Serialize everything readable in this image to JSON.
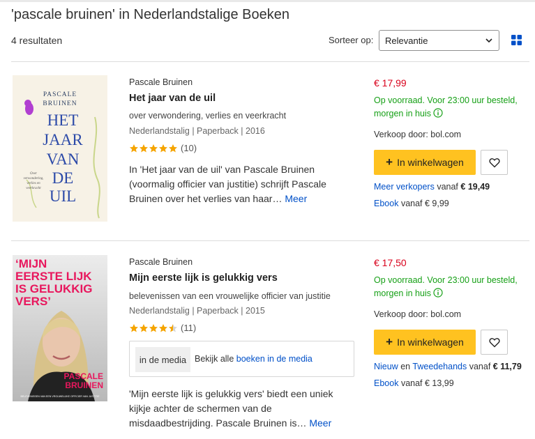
{
  "page": {
    "title": "'pascale bruinen' in Nederlandstalige Boeken",
    "result_count": "4 resultaten",
    "sort_label": "Sorteer op:",
    "sort_value": "Relevantie"
  },
  "colors": {
    "accent_button": "#ffc220",
    "price": "#d9001b",
    "stock": "#16a016",
    "link": "#0050c8"
  },
  "products": [
    {
      "author": "Pascale Bruinen",
      "title": "Het jaar van de uil",
      "subtitle": "over verwondering, verlies en veerkracht",
      "meta": "Nederlandstalig | Paperback | 2016",
      "rating_count": "(10)",
      "rating_value": 5,
      "description": "In 'Het jaar van de uil' van Pascale Bruinen (voormalig officier van justitie) schrijft Pascale Bruinen over het verlies van haar…",
      "more": "Meer",
      "price": "€ 17,99",
      "stock": "Op voorraad. Voor 23:00 uur besteld, morgen in huis",
      "seller": "Verkoop door: bol.com",
      "cart_label": "In winkelwagen",
      "offers_link": "Meer verkopers",
      "offers_from": "vanaf",
      "offers_price": "€ 19,49",
      "ebook_link": "Ebook",
      "ebook_from": "vanaf € 9,99",
      "cover": {
        "author": "PASCALE\nBRUINEN",
        "title_lines": [
          "HET",
          "JAAR",
          "VAN",
          "DE",
          "UIL"
        ],
        "tagline": "Over verwondering, verlies en veerkracht"
      }
    },
    {
      "author": "Pascale Bruinen",
      "title": "Mijn eerste lijk is gelukkig vers",
      "subtitle": "belevenissen van een vrouwelijke officier van justitie",
      "meta": "Nederlandstalig | Paperback | 2015",
      "rating_count": "(11)",
      "rating_value": 4.5,
      "media_tag": "in de media",
      "media_text": "Bekijk alle",
      "media_link": "boeken in de media",
      "description": "'Mijn eerste lijk is gelukkig vers' biedt een uniek kijkje achter de schermen van de misdaadbestrijding. Pascale Bruinen is…",
      "more": "Meer",
      "price": "€ 17,50",
      "stock": "Op voorraad. Voor 23:00 uur besteld, morgen in huis",
      "seller": "Verkoop door: bol.com",
      "cart_label": "In winkelwagen",
      "offers_link_new": "Nieuw",
      "offers_and": "en",
      "offers_link_used": "Tweedehands",
      "offers_from": "vanaf",
      "offers_price": "€ 11,79",
      "ebook_link": "Ebook",
      "ebook_from": "vanaf € 13,99",
      "cover": {
        "title_lines": [
          "‘MIJN",
          "EERSTE LIJK",
          "IS GELUKKIG",
          "VERS’"
        ],
        "author_lines": [
          "PASCALE",
          "BRUINEN"
        ],
        "tagline": "BELEVENISSEN VAN EEN VROUWELIJKE OFFICIER VAN JUSTITIE"
      }
    }
  ]
}
